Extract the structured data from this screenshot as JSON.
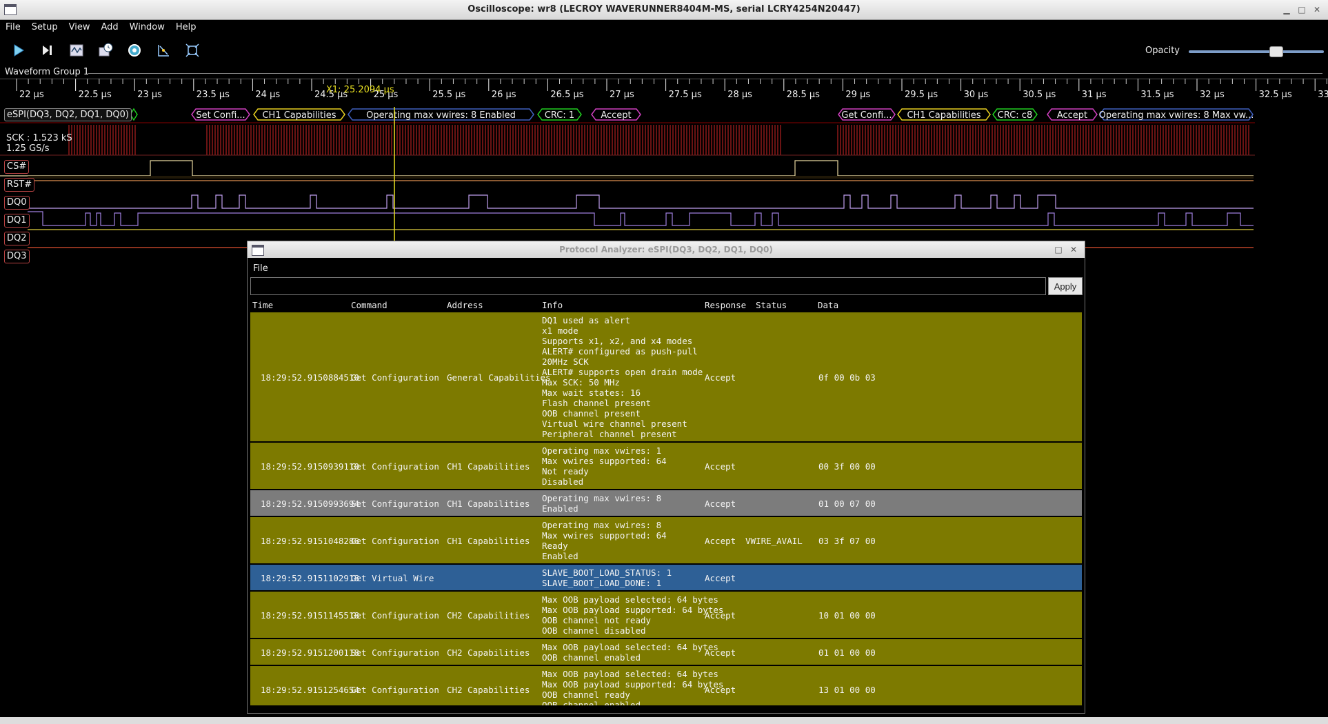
{
  "window": {
    "title": "Oscilloscope: wr8 (LECROY WAVERUNNER8404M-MS, serial LCRY4254N20447)"
  },
  "menu": [
    "File",
    "Setup",
    "View",
    "Add",
    "Window",
    "Help"
  ],
  "toolbar": {
    "icons": [
      "play-icon",
      "step-icon",
      "waveform-icon",
      "clock-capture-icon",
      "gear-target-icon",
      "cursor-measure-icon",
      "zoom-fit-icon"
    ],
    "opacity_label": "Opacity",
    "opacity_value": 0.6
  },
  "waveform_group": {
    "label": "Waveform Group 1"
  },
  "ruler": {
    "ticks": [
      "22 µs",
      "22.5 µs",
      "23 µs",
      "23.5 µs",
      "24 µs",
      "24.5 µs",
      "25 µs",
      "25.5 µs",
      "26 µs",
      "26.5 µs",
      "27 µs",
      "27.5 µs",
      "28 µs",
      "28.5 µs",
      "29 µs",
      "29.5 µs",
      "30 µs",
      "30.5 µs",
      "31 µs",
      "31.5 µs",
      "32 µs",
      "32.5 µs",
      "33"
    ]
  },
  "cursor": {
    "label": "X1: 25.2094 µs"
  },
  "decode": {
    "label": "eSPI(DQ3, DQ2, DQ1, DQ0)",
    "packets": [
      {
        "text": "Set Confi...",
        "color": "#d040c0"
      },
      {
        "text": "CH1 Capabilities",
        "color": "#e8d020"
      },
      {
        "text": "Operating max vwires: 8 Enabled",
        "color": "#4060c0"
      },
      {
        "text": "CRC: 1",
        "color": "#20d020"
      },
      {
        "text": "Accept",
        "color": "#d040c0"
      },
      {
        "text": "Get Confi...",
        "color": "#d040c0"
      },
      {
        "text": "CH1 Capabilities",
        "color": "#e8d020"
      },
      {
        "text": "CRC: c8",
        "color": "#20d020"
      },
      {
        "text": "Accept",
        "color": "#d040c0"
      },
      {
        "text": "Operating max vwires: 8 Max vw...",
        "color": "#4060c0"
      }
    ]
  },
  "channels": {
    "sck": {
      "line1": "SCK : 1.523 kS",
      "line2": "1.25 GS/s"
    },
    "cs": "CS#",
    "rst": "RST#",
    "dq0": "DQ0",
    "dq1": "DQ1",
    "dq2": "DQ2",
    "dq3": "DQ3"
  },
  "analyzer": {
    "title": "Protocol Analyzer: eSPI(DQ3, DQ2, DQ1, DQ0)",
    "menu_file": "File",
    "filter_value": "",
    "apply_label": "Apply",
    "columns": [
      "Time",
      "Command",
      "Address",
      "Info",
      "Response",
      "Status",
      "Data"
    ],
    "rows": [
      {
        "time": "18:29:52.9150884510",
        "command": "Get Configuration",
        "address": "General Capabilities",
        "info": "DQ1 used as alert\nx1 mode\nSupports x1, x2, and x4 modes\nALERT# configured as push-pull\n20MHz SCK\nALERT# supports open drain mode\nMax SCK: 50 MHz\nMax wait states: 16\nFlash channel present\nOOB channel present\nVirtual wire channel present\nPeripheral channel present",
        "response": "Accept",
        "status": "",
        "data": "0f 00 0b 03",
        "style": "olive"
      },
      {
        "time": "18:29:52.9150939110",
        "command": "Get Configuration",
        "address": "CH1 Capabilities",
        "info": "Operating max vwires: 1\nMax vwires supported: 64\nNot ready\nDisabled",
        "response": "Accept",
        "status": "",
        "data": "00 3f 00 00",
        "style": "olive"
      },
      {
        "time": "18:29:52.9150993694",
        "command": "Set Configuration",
        "address": "CH1 Capabilities",
        "info": "Operating max vwires: 8\nEnabled",
        "response": "Accept",
        "status": "",
        "data": "01 00 07 00",
        "style": "gray"
      },
      {
        "time": "18:29:52.9151048286",
        "command": "Get Configuration",
        "address": "CH1 Capabilities",
        "info": "Operating max vwires: 8\nMax vwires supported: 64\nReady\nEnabled",
        "response": "Accept",
        "status": "VWIRE_AVAIL",
        "data": "03 3f 07 00",
        "style": "olive"
      },
      {
        "time": "18:29:52.9151102918",
        "command": "Get Virtual Wire",
        "address": "",
        "info": "SLAVE_BOOT_LOAD_STATUS: 1\nSLAVE_BOOT_LOAD_DONE: 1",
        "response": "Accept",
        "status": "",
        "data": "",
        "style": "sel"
      },
      {
        "time": "18:29:52.9151145518",
        "command": "Get Configuration",
        "address": "CH2 Capabilities",
        "info": "Max OOB payload selected: 64 bytes\nMax OOB payload supported: 64 bytes\nOOB channel not ready\nOOB channel disabled",
        "response": "Accept",
        "status": "",
        "data": "10 01 00 00",
        "style": "olive"
      },
      {
        "time": "18:29:52.9151200118",
        "command": "Set Configuration",
        "address": "CH2 Capabilities",
        "info": "Max OOB payload selected: 64 bytes\nOOB channel enabled",
        "response": "Accept",
        "status": "",
        "data": "01 01 00 00",
        "style": "olive"
      },
      {
        "time": "18:29:52.9151254654",
        "command": "Get Configuration",
        "address": "CH2 Capabilities",
        "info": "Max OOB payload selected: 64 bytes\nMax OOB payload supported: 64 bytes\nOOB channel ready\nOOB channel enabled",
        "response": "Accept",
        "status": "",
        "data": "13 01 00 00",
        "style": "olive"
      }
    ]
  }
}
